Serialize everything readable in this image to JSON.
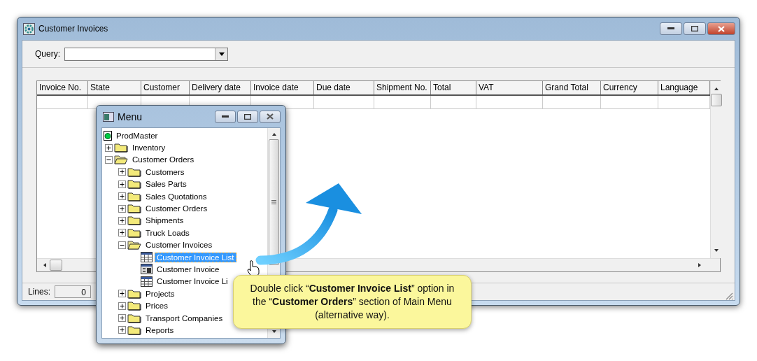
{
  "window": {
    "title": "Customer Invoices",
    "query": {
      "label": "Query:"
    },
    "table": {
      "columns": [
        "Invoice No.",
        "State",
        "Customer",
        "Delivery date",
        "Invoice date",
        "Due date",
        "Shipment No.",
        "Total",
        "VAT",
        "Grand Total",
        "Currency",
        "Language"
      ]
    },
    "status_bar": {
      "label": "Lines:",
      "value": "0"
    }
  },
  "menu_window": {
    "title": "Menu",
    "tree": [
      {
        "label": "ProdMaster",
        "kind": "root",
        "selected": false,
        "children": [
          {
            "label": "Inventory",
            "kind": "folder",
            "expanded": false,
            "selected": false
          },
          {
            "label": "Customer Orders",
            "kind": "folder",
            "expanded": true,
            "selected": false,
            "children": [
              {
                "label": "Customers",
                "kind": "folder",
                "expanded": false,
                "selected": false
              },
              {
                "label": "Sales Parts",
                "kind": "folder",
                "expanded": false,
                "selected": false
              },
              {
                "label": "Sales Quotations",
                "kind": "folder",
                "expanded": false,
                "selected": false
              },
              {
                "label": "Customer Orders",
                "kind": "folder",
                "expanded": false,
                "selected": false
              },
              {
                "label": "Shipments",
                "kind": "folder",
                "expanded": false,
                "selected": false
              },
              {
                "label": "Truck Loads",
                "kind": "folder",
                "expanded": false,
                "selected": false
              },
              {
                "label": "Customer Invoices",
                "kind": "folder",
                "expanded": true,
                "selected": false,
                "children": [
                  {
                    "label": "Customer Invoice List",
                    "kind": "table",
                    "selected": true
                  },
                  {
                    "label": "Customer Invoice",
                    "kind": "form",
                    "selected": false
                  },
                  {
                    "label": "Customer Invoice Li",
                    "kind": "table",
                    "selected": false
                  }
                ]
              },
              {
                "label": "Projects",
                "kind": "folder",
                "expanded": false,
                "selected": false
              },
              {
                "label": "Prices",
                "kind": "folder",
                "expanded": false,
                "selected": false
              },
              {
                "label": "Transport Companies",
                "kind": "folder",
                "expanded": false,
                "selected": false
              },
              {
                "label": "Reports",
                "kind": "folder",
                "expanded": false,
                "selected": false
              }
            ]
          }
        ]
      }
    ]
  },
  "callout": {
    "text": "Double click “**Customer Invoice List**” option in the “**Customer Orders**” section of Main Menu (alternative way)."
  }
}
